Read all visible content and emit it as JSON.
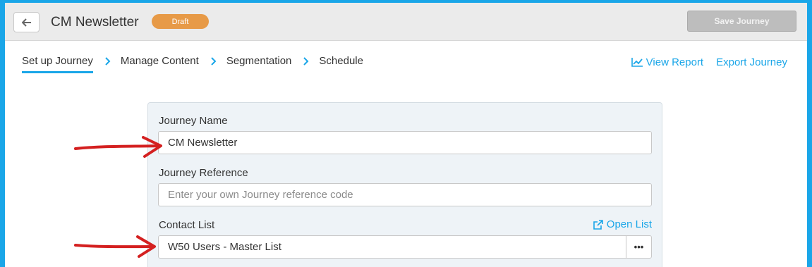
{
  "header": {
    "back_icon": "arrow-left-icon",
    "title": "CM Newsletter",
    "status_badge": "Draft",
    "save_label": "Save Journey",
    "colors": {
      "badge": "#e79a47",
      "accent": "#1aa6e8",
      "save_disabled": "#bdbdbd"
    }
  },
  "steps": [
    {
      "label": "Set up Journey",
      "active": true
    },
    {
      "label": "Manage Content",
      "active": false
    },
    {
      "label": "Segmentation",
      "active": false
    },
    {
      "label": "Schedule",
      "active": false
    }
  ],
  "actions": {
    "view_report": "View Report",
    "view_report_icon": "line-chart-icon",
    "export_journey": "Export Journey"
  },
  "form": {
    "journey_name": {
      "label": "Journey Name",
      "value": "CM Newsletter"
    },
    "journey_reference": {
      "label": "Journey Reference",
      "placeholder": "Enter your own Journey reference code"
    },
    "contact_list": {
      "label": "Contact List",
      "value": "W50 Users - Master List",
      "open_list": "Open List",
      "open_list_icon": "external-link-icon",
      "picker_label": "•••"
    }
  },
  "annotations": {
    "arrow_color": "#d42020"
  }
}
